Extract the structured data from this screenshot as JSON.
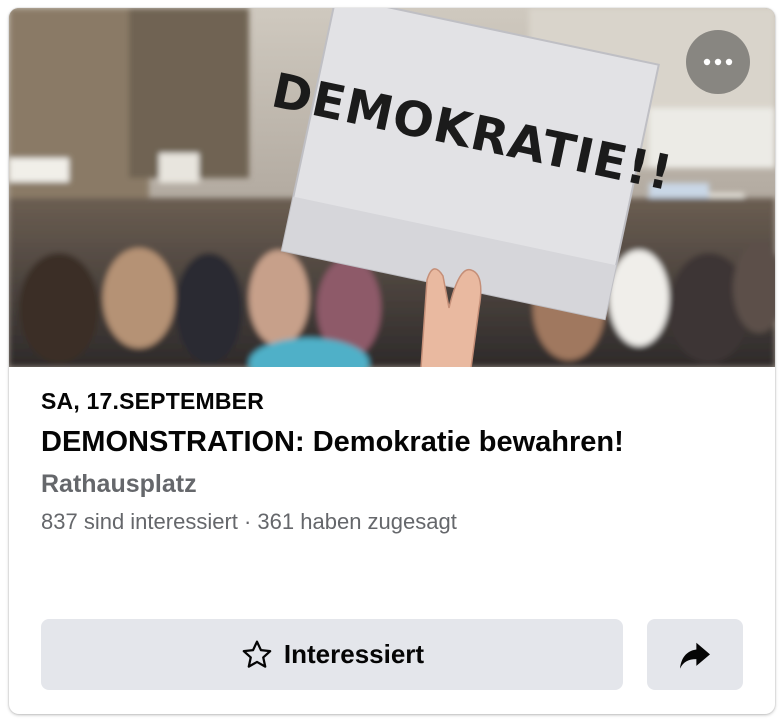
{
  "event": {
    "date": "SA, 17.SEPTEMBER",
    "title": "DEMONSTRATION: Demokratie bewahren!",
    "location": "Rathausplatz",
    "stats": "837 sind interessiert · 361 haben zugesagt"
  },
  "cover": {
    "sign_text": "DEMOKRATIE!!"
  },
  "actions": {
    "interested_label": "Interessiert",
    "interested_icon": "star-outline-icon",
    "share_icon": "share-arrow-icon",
    "more_icon": "more-horizontal-icon"
  },
  "colors": {
    "button_bg": "#e4e6eb",
    "primary_text": "#050505",
    "secondary_text": "#65676b"
  }
}
